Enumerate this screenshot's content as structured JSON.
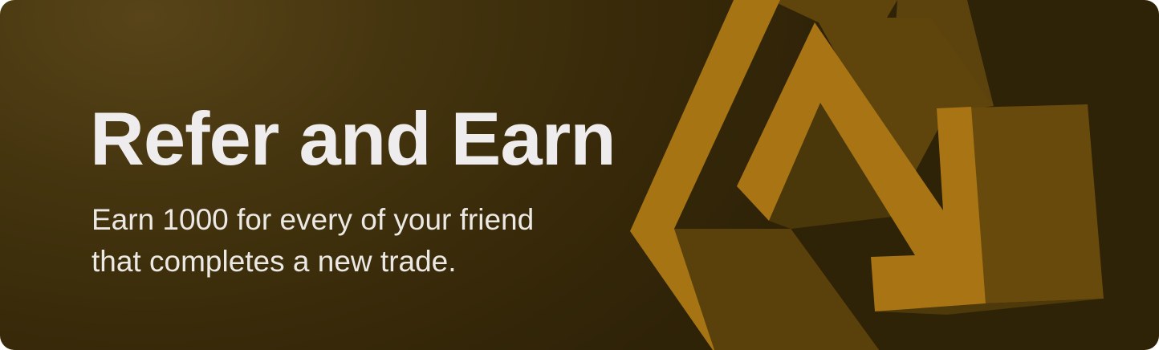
{
  "banner": {
    "title": "Refer and Earn",
    "subtitle_line1": "Earn 1000 for every of your friend",
    "subtitle_line2": "that completes a new trade.",
    "colors": {
      "background_dark": "#2e2207",
      "background_light": "#584418",
      "accent_gold": "#a87414",
      "shape_brown": "#6a4c0c",
      "text": "#efeced"
    },
    "graphic": "refer-arrows-icon"
  }
}
